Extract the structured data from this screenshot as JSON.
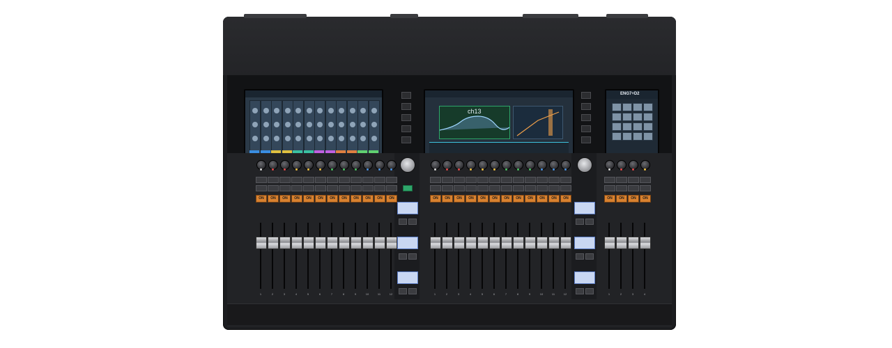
{
  "device": {
    "name": "digital-mixing-console"
  },
  "center_screen": {
    "channel_label": "ch13"
  },
  "right_screen": {
    "title": "ENG7+D2"
  },
  "fader_strips": {
    "on_label": "ON",
    "bank_left": [
      "1",
      "2",
      "3",
      "4",
      "5",
      "6",
      "7",
      "8",
      "9",
      "10",
      "11",
      "12"
    ],
    "bank_center": [
      "1",
      "2",
      "3",
      "4",
      "5",
      "6",
      "7",
      "8",
      "9",
      "10",
      "11",
      "12"
    ],
    "bank_right": [
      "1",
      "2",
      "3",
      "4"
    ]
  },
  "colors": {
    "body": "#1c1d20",
    "on_button": "#d8812f",
    "screen_accent_green": "#2ea66a",
    "screen_accent_cyan": "#3ec4e0"
  }
}
